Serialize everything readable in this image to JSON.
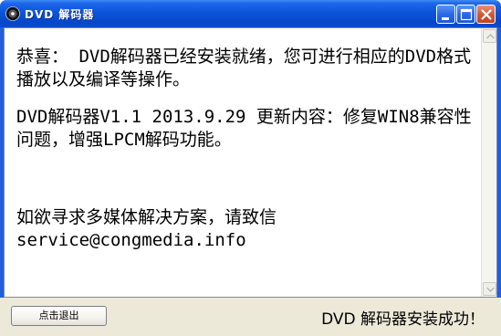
{
  "window": {
    "title": "DVD 解码器",
    "controls": [
      "minimize",
      "maximize",
      "close"
    ]
  },
  "content": {
    "paragraphs": [
      "恭喜： DVD解码器已经安装就绪，您可进行相应的DVD格式播放以及编译等操作。",
      "DVD解码器V1.1 2013.9.29 更新内容：修复WIN8兼容性问题，增强LPCM解码功能。",
      "如欲寻求多媒体解决方案，请致信service@congmedia.info"
    ]
  },
  "footer": {
    "exit_button_label": "点击退出",
    "status_message": "DVD 解码器安装成功！"
  },
  "icons": {
    "app": "dvd-disc-icon",
    "scroll_up": "scroll-up-arrow-icon",
    "scroll_down": "scroll-down-arrow-icon"
  },
  "colors": {
    "titlebar": "#0a55dc",
    "close_button": "#d45a38",
    "dialog_bg": "#ece9d8"
  }
}
